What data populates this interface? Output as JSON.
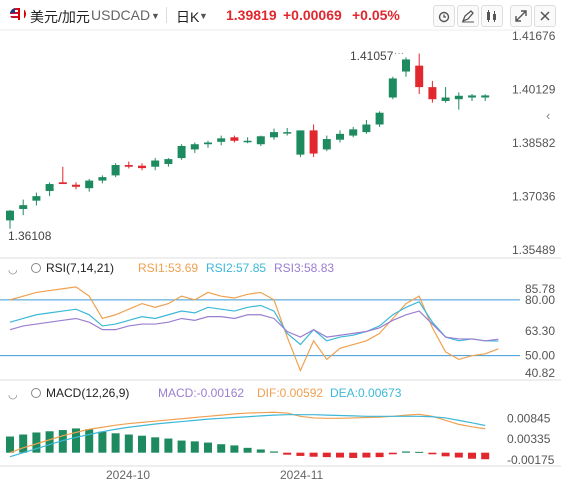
{
  "header": {
    "symbol_name": "美元/加元",
    "symbol_code": "USDCAD",
    "period": "日K",
    "last_price": "1.39819",
    "change": "+0.00069",
    "change_pct": "+0.05%",
    "icons": [
      "alarm-icon",
      "draw-icon",
      "indicator-icon",
      "fullscreen-icon",
      "close-icon"
    ]
  },
  "colors": {
    "up": "#1e8a5f",
    "down": "#e0282e",
    "rsi1": "#f0a050",
    "rsi2": "#3cb8d8",
    "rsi3": "#9b7fd0",
    "dif": "#f0a050",
    "dea": "#3cb8d8"
  },
  "main_chart": {
    "y_ticks": [
      "1.41676",
      "1.40129",
      "1.38582",
      "1.37036",
      "1.35489"
    ],
    "high_label": "1.41057",
    "low_label": "1.36108"
  },
  "rsi_panel": {
    "title": "RSI(7,14,21)",
    "rsi1": "RSI1:53.69",
    "rsi2": "RSI2:57.85",
    "rsi3": "RSI3:58.83",
    "y_ticks": [
      "85.78",
      "80.00",
      "63.30",
      "50.00",
      "40.82"
    ]
  },
  "macd_panel": {
    "title": "MACD(12,26,9)",
    "macd": "MACD:-0.00162",
    "dif": "DIF:0.00592",
    "dea": "DEA:0.00673",
    "y_ticks": [
      "0.00845",
      "0.00335",
      "-0.00175"
    ]
  },
  "x_axis": {
    "labels": [
      "2024-10",
      "2024-11"
    ]
  },
  "chart_data": [
    {
      "type": "candlestick",
      "title": "USDCAD 日K",
      "y_ticks": [
        1.41676,
        1.40129,
        1.38582,
        1.37036,
        1.35489
      ],
      "ylim": [
        1.3535,
        1.4185
      ],
      "candles": [
        {
          "o": 1.3635,
          "h": 1.3665,
          "l": 1.3611,
          "c": 1.3663
        },
        {
          "o": 1.3668,
          "h": 1.3695,
          "l": 1.365,
          "c": 1.3679
        },
        {
          "o": 1.3692,
          "h": 1.3715,
          "l": 1.3678,
          "c": 1.3705
        },
        {
          "o": 1.372,
          "h": 1.3745,
          "l": 1.3705,
          "c": 1.374
        },
        {
          "o": 1.3745,
          "h": 1.379,
          "l": 1.374,
          "c": 1.374
        },
        {
          "o": 1.3738,
          "h": 1.3745,
          "l": 1.3725,
          "c": 1.3732
        },
        {
          "o": 1.3728,
          "h": 1.3755,
          "l": 1.3718,
          "c": 1.375
        },
        {
          "o": 1.375,
          "h": 1.3765,
          "l": 1.3742,
          "c": 1.376
        },
        {
          "o": 1.3765,
          "h": 1.38,
          "l": 1.376,
          "c": 1.3795
        },
        {
          "o": 1.3795,
          "h": 1.3805,
          "l": 1.3785,
          "c": 1.379
        },
        {
          "o": 1.3793,
          "h": 1.38,
          "l": 1.378,
          "c": 1.3786
        },
        {
          "o": 1.379,
          "h": 1.3815,
          "l": 1.378,
          "c": 1.3808
        },
        {
          "o": 1.3798,
          "h": 1.3815,
          "l": 1.379,
          "c": 1.3812
        },
        {
          "o": 1.3815,
          "h": 1.3855,
          "l": 1.381,
          "c": 1.385
        },
        {
          "o": 1.384,
          "h": 1.386,
          "l": 1.383,
          "c": 1.3855
        },
        {
          "o": 1.3855,
          "h": 1.3865,
          "l": 1.3845,
          "c": 1.386
        },
        {
          "o": 1.3862,
          "h": 1.388,
          "l": 1.3852,
          "c": 1.3872
        },
        {
          "o": 1.3875,
          "h": 1.388,
          "l": 1.386,
          "c": 1.3865
        },
        {
          "o": 1.3865,
          "h": 1.3875,
          "l": 1.3858,
          "c": 1.3865
        },
        {
          "o": 1.3855,
          "h": 1.388,
          "l": 1.385,
          "c": 1.3878
        },
        {
          "o": 1.3875,
          "h": 1.39,
          "l": 1.3868,
          "c": 1.389
        },
        {
          "o": 1.3886,
          "h": 1.3902,
          "l": 1.388,
          "c": 1.389
        },
        {
          "o": 1.3825,
          "h": 1.3895,
          "l": 1.3818,
          "c": 1.3895
        },
        {
          "o": 1.3895,
          "h": 1.3912,
          "l": 1.3818,
          "c": 1.3828
        },
        {
          "o": 1.384,
          "h": 1.388,
          "l": 1.3835,
          "c": 1.387
        },
        {
          "o": 1.3868,
          "h": 1.3895,
          "l": 1.386,
          "c": 1.3885
        },
        {
          "o": 1.388,
          "h": 1.3905,
          "l": 1.3875,
          "c": 1.3898
        },
        {
          "o": 1.389,
          "h": 1.3925,
          "l": 1.3885,
          "c": 1.3912
        },
        {
          "o": 1.3912,
          "h": 1.395,
          "l": 1.3905,
          "c": 1.3946
        },
        {
          "o": 1.399,
          "h": 1.405,
          "l": 1.3985,
          "c": 1.4045
        },
        {
          "o": 1.4065,
          "h": 1.4106,
          "l": 1.405,
          "c": 1.41
        },
        {
          "o": 1.4082,
          "h": 1.4117,
          "l": 1.4,
          "c": 1.402
        },
        {
          "o": 1.402,
          "h": 1.4038,
          "l": 1.3975,
          "c": 1.3985
        },
        {
          "o": 1.398,
          "h": 1.402,
          "l": 1.3975,
          "c": 1.399
        },
        {
          "o": 1.3985,
          "h": 1.4005,
          "l": 1.3955,
          "c": 1.3995
        },
        {
          "o": 1.399,
          "h": 1.4,
          "l": 1.398,
          "c": 1.3996
        },
        {
          "o": 1.399,
          "h": 1.3999,
          "l": 1.398,
          "c": 1.3996
        }
      ]
    },
    {
      "type": "line",
      "title": "RSI(7,14,21)",
      "ylim": [
        38,
        88
      ],
      "y_ticks": [
        85.78,
        80.0,
        63.3,
        50.0,
        40.82
      ],
      "series": [
        {
          "name": "RSI1",
          "values": [
            80,
            82,
            84,
            85,
            86,
            87,
            82,
            70,
            72,
            75,
            78,
            76,
            78,
            82,
            80,
            84,
            82,
            81,
            83,
            84,
            80,
            60,
            42,
            58,
            48,
            54,
            56,
            58,
            62,
            70,
            78,
            82,
            65,
            52,
            48,
            50,
            51,
            53.69
          ]
        },
        {
          "name": "RSI2",
          "values": [
            68,
            70,
            72,
            73,
            74,
            75,
            72,
            66,
            67,
            69,
            71,
            70,
            72,
            74,
            73,
            76,
            75,
            74,
            76,
            77,
            74,
            62,
            56,
            64,
            58,
            60,
            61,
            63,
            66,
            72,
            76,
            79,
            68,
            60,
            58,
            59,
            58,
            57.85
          ]
        },
        {
          "name": "RSI3",
          "values": [
            64,
            66,
            67,
            68,
            69,
            70,
            68,
            64,
            64,
            66,
            67,
            67,
            68,
            70,
            69,
            71,
            71,
            70,
            72,
            72,
            70,
            63,
            60,
            64,
            60,
            61,
            62,
            63,
            65,
            69,
            72,
            74,
            67,
            60,
            59,
            59,
            58,
            58.83
          ]
        }
      ]
    },
    {
      "type": "bar",
      "title": "MACD(12,26,9)",
      "ylim": [
        -0.0028,
        0.0118
      ],
      "y_ticks": [
        0.00845,
        0.00335,
        -0.00175
      ],
      "histogram": [
        0.004,
        0.0045,
        0.005,
        0.0053,
        0.0056,
        0.006,
        0.0058,
        0.0052,
        0.0048,
        0.0045,
        0.0042,
        0.0038,
        0.0035,
        0.003,
        0.0028,
        0.0025,
        0.0021,
        0.0018,
        0.0012,
        0.0008,
        0.0003,
        -0.0005,
        -0.0008,
        -0.001,
        -0.0011,
        -0.0012,
        -0.0013,
        -0.0012,
        -0.0011,
        -0.0004,
        0.0003,
        0.0002,
        -0.0004,
        -0.0009,
        -0.0012,
        -0.0015,
        -0.00162
      ],
      "series": [
        {
          "name": "DIF",
          "values": [
            0.0,
            0.0012,
            0.0022,
            0.0032,
            0.0042,
            0.005,
            0.0058,
            0.0063,
            0.0068,
            0.0072,
            0.0075,
            0.0078,
            0.0081,
            0.0084,
            0.0087,
            0.009,
            0.0093,
            0.0096,
            0.0098,
            0.0099,
            0.01,
            0.0098,
            0.009,
            0.0086,
            0.0085,
            0.0085,
            0.0086,
            0.0087,
            0.0088,
            0.009,
            0.0093,
            0.0095,
            0.009,
            0.008,
            0.007,
            0.0064,
            0.00592
          ]
        },
        {
          "name": "DEA",
          "values": [
            -0.001,
            0.0,
            0.001,
            0.002,
            0.003,
            0.0038,
            0.0045,
            0.0052,
            0.0058,
            0.0063,
            0.0067,
            0.0071,
            0.0074,
            0.0077,
            0.008,
            0.0083,
            0.0085,
            0.0087,
            0.0089,
            0.0091,
            0.0093,
            0.0094,
            0.0094,
            0.0094,
            0.0093,
            0.0092,
            0.0091,
            0.009,
            0.009,
            0.009,
            0.009,
            0.009,
            0.0089,
            0.0086,
            0.008,
            0.0074,
            0.00673
          ]
        }
      ]
    }
  ]
}
